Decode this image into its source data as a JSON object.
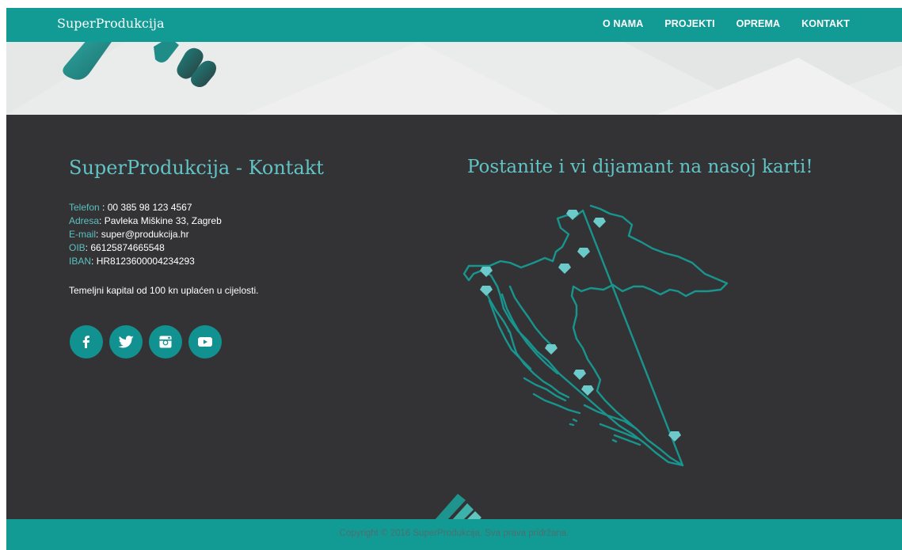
{
  "navbar": {
    "brand": "SuperProdukcija",
    "links": [
      "O NAMA",
      "PROJEKTI",
      "OPREMA",
      "KONTAKT"
    ]
  },
  "contact": {
    "title": "SuperProdukcija - Kontakt",
    "rows": [
      {
        "key": "Telefon",
        "sep": " : ",
        "value": "00 385 98 123 4567"
      },
      {
        "key": "Adresa",
        "sep": ": ",
        "value": "Pavleka Miškine 33, Zagreb"
      },
      {
        "key": "E-mail",
        "sep": ": ",
        "value": "super@produkcija.hr"
      },
      {
        "key": "OIB",
        "sep": ": ",
        "value": "66125874665548"
      },
      {
        "key": "IBAN",
        "sep": ": ",
        "value": "HR8123600004234293"
      }
    ],
    "capital_note": "Temeljni kapital od 100 kn uplaćen u cijelosti."
  },
  "social": [
    "facebook-icon",
    "twitter-icon",
    "instagram-icon",
    "youtube-icon"
  ],
  "map": {
    "title": "Postanite i vi dijamant na nasoj karti!",
    "marker_icon": "diamond-icon",
    "marker_count": 10
  },
  "footer": {
    "copyright": "Copyright © 2016 SuperProdukcija. Sva prava pridržana."
  },
  "colors": {
    "teal": "#129a94",
    "accent_text": "#62c3c4",
    "background_dark": "#333335"
  }
}
